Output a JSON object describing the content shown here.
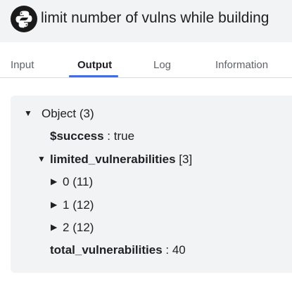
{
  "header": {
    "title": "limit number of vulns while building",
    "logo_icon": "python-icon"
  },
  "tabs": {
    "input": "Input",
    "output": "Output",
    "log": "Log",
    "information": "Information",
    "active": "Output"
  },
  "tree": {
    "root": {
      "label": "Object",
      "count": "(3)",
      "expanded_icon": "▼"
    },
    "success": {
      "key": "$success",
      "sep": " : ",
      "value": "true"
    },
    "limited": {
      "key": "limited_vulnerabilities",
      "count": "[3]",
      "expanded_icon": "▼"
    },
    "items": [
      {
        "index": "0",
        "count": "(11)",
        "collapsed_icon": "▶"
      },
      {
        "index": "1",
        "count": "(12)",
        "collapsed_icon": "▶"
      },
      {
        "index": "2",
        "count": "(12)",
        "collapsed_icon": "▶"
      }
    ],
    "total": {
      "key": "total_vulnerabilities",
      "sep": " : ",
      "value": "40"
    }
  },
  "colors": {
    "accent": "#3b6cf5",
    "header_bg": "#f1f3f4",
    "panel_bg": "#f1f3f4"
  }
}
